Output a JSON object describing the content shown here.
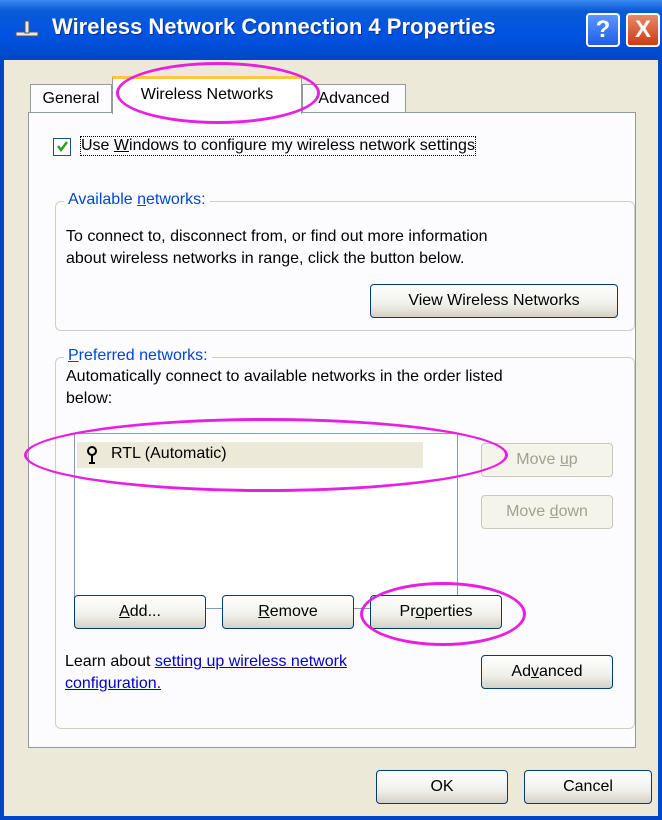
{
  "window": {
    "title": "Wireless Network Connection 4 Properties",
    "help_glyph": "?",
    "close_glyph": "X"
  },
  "tabs": [
    {
      "label": "General",
      "active": false
    },
    {
      "label": "Wireless Networks",
      "active": true
    },
    {
      "label": "Advanced",
      "active": false
    }
  ],
  "use_windows": {
    "pre": "Use ",
    "accel": "W",
    "post": "indows to configure my wireless network settings",
    "checked": true
  },
  "available": {
    "label_pre": "Available ",
    "label_accel": "n",
    "label_post": "etworks:",
    "line1": "To connect to, disconnect from, or find out more information",
    "line2": "about wireless networks in range, click the button below.",
    "view_button": "View Wireless Networks"
  },
  "preferred": {
    "label_accel": "P",
    "label_post": "referred networks:",
    "line1": "Automatically connect to available networks in the order listed",
    "line2": "below:",
    "networks": [
      {
        "name": "RTL (Automatic)",
        "icon": "antenna-icon"
      }
    ],
    "move_up": {
      "pre": "Move ",
      "accel": "u",
      "post": "p"
    },
    "move_down": {
      "pre": "Move ",
      "accel": "d",
      "post": "own"
    },
    "add": {
      "accel": "A",
      "post": "dd..."
    },
    "remove": {
      "accel": "R",
      "post": "emove"
    },
    "properties": {
      "pre": "Pr",
      "accel": "o",
      "post": "perties"
    }
  },
  "learn": {
    "prefix": "Learn about ",
    "link1": "setting up wireless network",
    "link2": "configuration."
  },
  "advanced_button": {
    "pre": "Ad",
    "accel": "v",
    "post": "anced"
  },
  "ok_button": "OK",
  "cancel_button": "Cancel",
  "colors": {
    "titlebar": "#0054e3",
    "dialog_bg": "#ECE9D8",
    "highlight_ellipse": "#e81fe0",
    "link": "#0000cc"
  }
}
